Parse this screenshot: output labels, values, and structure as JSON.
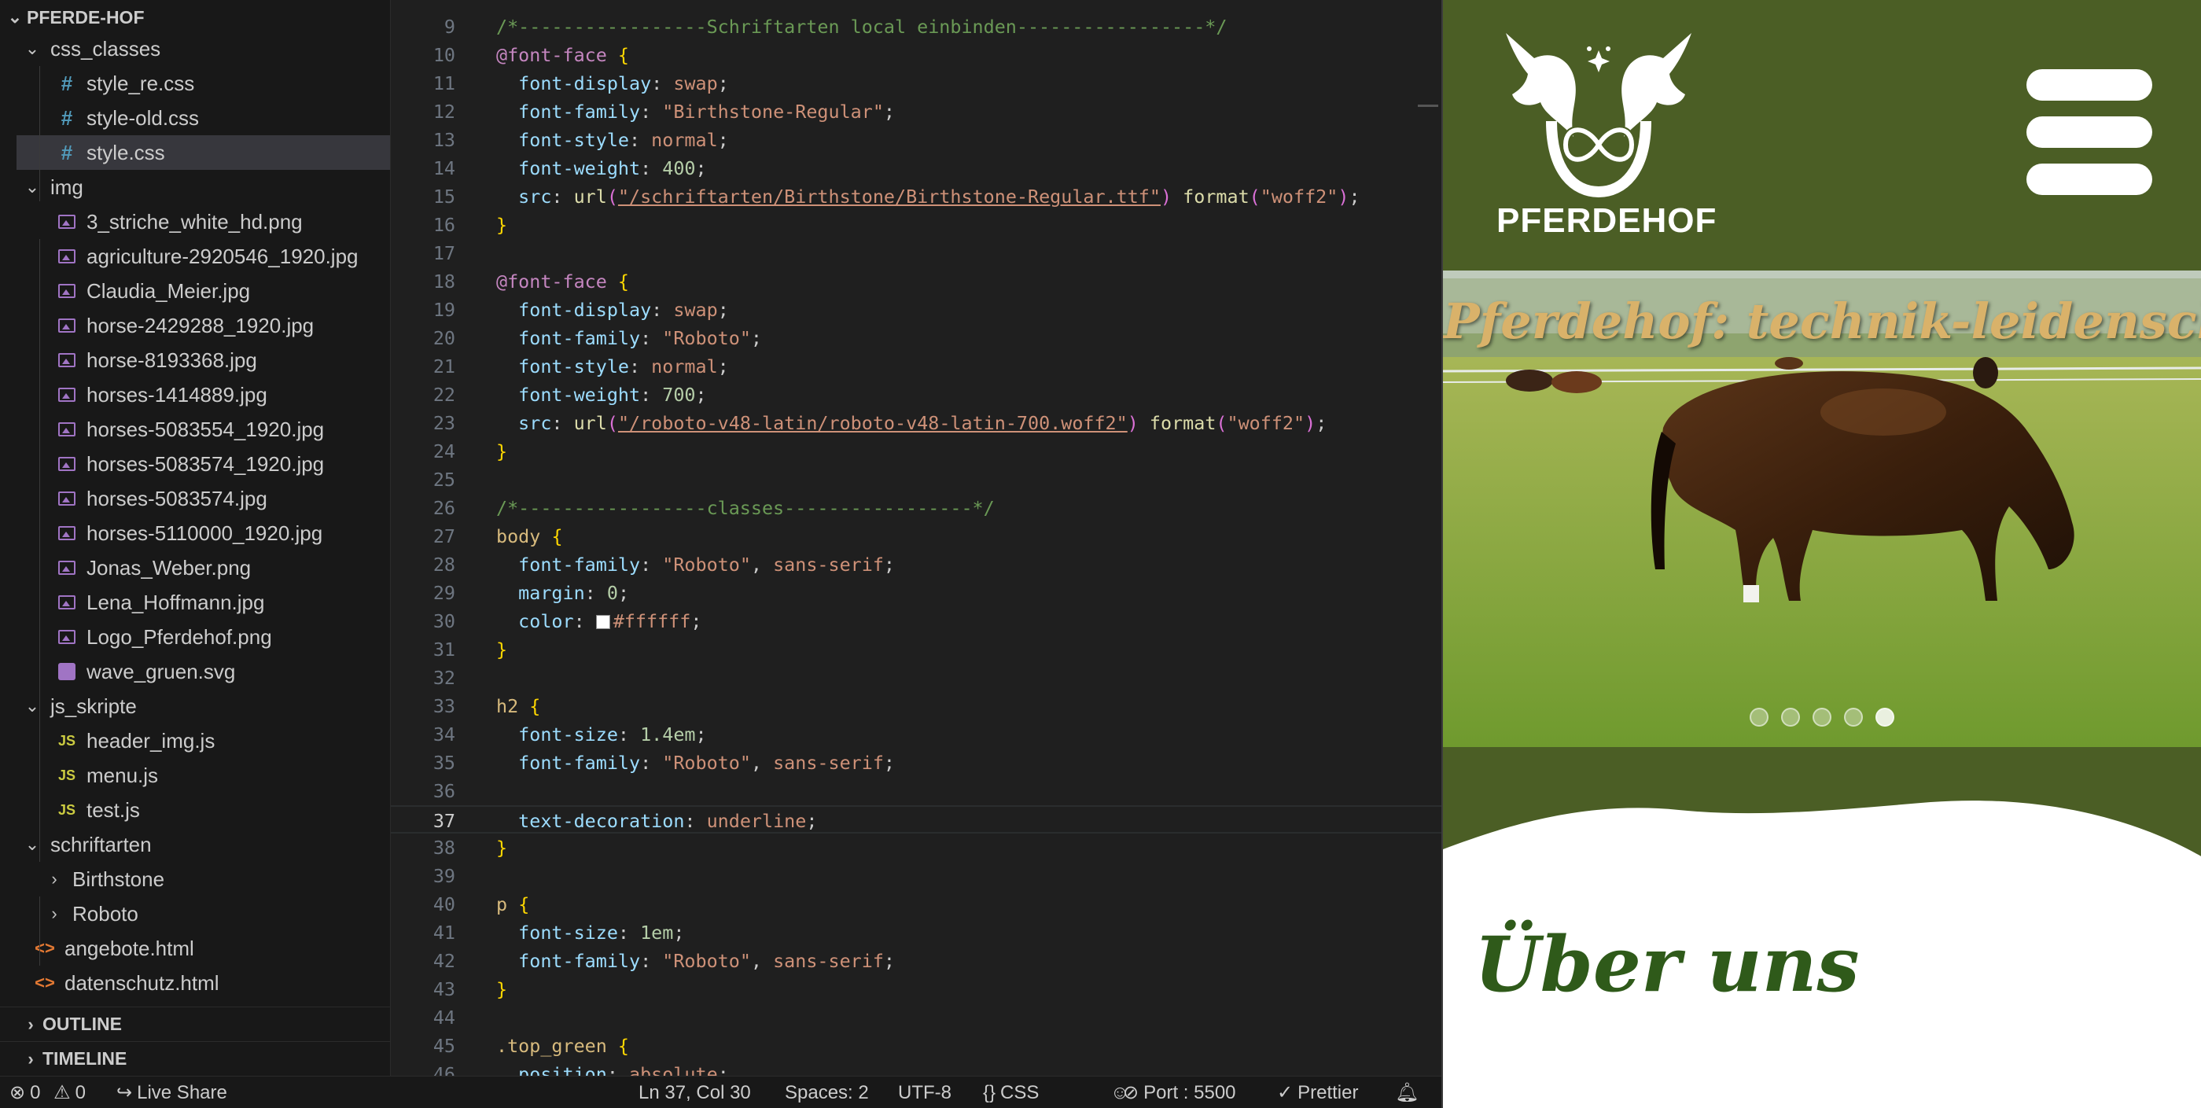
{
  "explorer": {
    "project": "PFERDE-HOF",
    "items": [
      {
        "label": "css_classes",
        "kind": "folder",
        "open": true,
        "depth": 1
      },
      {
        "label": "style_re.css",
        "kind": "css",
        "depth": 2
      },
      {
        "label": "style-old.css",
        "kind": "css",
        "depth": 2
      },
      {
        "label": "style.css",
        "kind": "css",
        "depth": 2,
        "selected": true
      },
      {
        "label": "img",
        "kind": "folder",
        "open": true,
        "depth": 1
      },
      {
        "label": "3_striche_white_hd.png",
        "kind": "image",
        "depth": 2
      },
      {
        "label": "agriculture-2920546_1920.jpg",
        "kind": "image",
        "depth": 2
      },
      {
        "label": "Claudia_Meier.jpg",
        "kind": "image",
        "depth": 2
      },
      {
        "label": "horse-2429288_1920.jpg",
        "kind": "image",
        "depth": 2
      },
      {
        "label": "horse-8193368.jpg",
        "kind": "image",
        "depth": 2
      },
      {
        "label": "horses-1414889.jpg",
        "kind": "image",
        "depth": 2
      },
      {
        "label": "horses-5083554_1920.jpg",
        "kind": "image",
        "depth": 2
      },
      {
        "label": "horses-5083574_1920.jpg",
        "kind": "image",
        "depth": 2
      },
      {
        "label": "horses-5083574.jpg",
        "kind": "image",
        "depth": 2
      },
      {
        "label": "horses-5110000_1920.jpg",
        "kind": "image",
        "depth": 2
      },
      {
        "label": "Jonas_Weber.png",
        "kind": "image",
        "depth": 2
      },
      {
        "label": "Lena_Hoffmann.jpg",
        "kind": "image",
        "depth": 2
      },
      {
        "label": "Logo_Pferdehof.png",
        "kind": "image",
        "depth": 2
      },
      {
        "label": "wave_gruen.svg",
        "kind": "svg",
        "depth": 2
      },
      {
        "label": "js_skripte",
        "kind": "folder",
        "open": true,
        "depth": 1
      },
      {
        "label": "header_img.js",
        "kind": "js",
        "depth": 2
      },
      {
        "label": "menu.js",
        "kind": "js",
        "depth": 2
      },
      {
        "label": "test.js",
        "kind": "js",
        "depth": 2
      },
      {
        "label": "schriftarten",
        "kind": "folder",
        "open": true,
        "depth": 1
      },
      {
        "label": "Birthstone",
        "kind": "folder",
        "open": false,
        "depth": 2
      },
      {
        "label": "Roboto",
        "kind": "folder",
        "open": false,
        "depth": 2
      },
      {
        "label": "angebote.html",
        "kind": "html",
        "depth": 1
      },
      {
        "label": "datenschutz.html",
        "kind": "html",
        "depth": 1
      }
    ],
    "sections": [
      "OUTLINE",
      "TIMELINE"
    ]
  },
  "editor": {
    "active_line": 37,
    "lines": [
      {
        "n": "9",
        "tokens": [
          [
            "com",
            "/*-----------------Schriftarten local einbinden-----------------*/"
          ]
        ]
      },
      {
        "n": "10",
        "tokens": [
          [
            "at",
            "@font-face"
          ],
          [
            "pun",
            " "
          ],
          [
            "brace",
            "{"
          ]
        ]
      },
      {
        "n": "11",
        "tokens": [
          [
            "pun",
            "  "
          ],
          [
            "prop",
            "font-display"
          ],
          [
            "pun",
            ": "
          ],
          [
            "val",
            "swap"
          ],
          [
            "pun",
            ";"
          ]
        ]
      },
      {
        "n": "12",
        "tokens": [
          [
            "pun",
            "  "
          ],
          [
            "prop",
            "font-family"
          ],
          [
            "pun",
            ": "
          ],
          [
            "val",
            "\"Birthstone-Regular\""
          ],
          [
            "pun",
            ";"
          ]
        ]
      },
      {
        "n": "13",
        "tokens": [
          [
            "pun",
            "  "
          ],
          [
            "prop",
            "font-style"
          ],
          [
            "pun",
            ": "
          ],
          [
            "val",
            "normal"
          ],
          [
            "pun",
            ";"
          ]
        ]
      },
      {
        "n": "14",
        "tokens": [
          [
            "pun",
            "  "
          ],
          [
            "prop",
            "font-weight"
          ],
          [
            "pun",
            ": "
          ],
          [
            "num",
            "400"
          ],
          [
            "pun",
            ";"
          ]
        ]
      },
      {
        "n": "15",
        "tokens": [
          [
            "pun",
            "  "
          ],
          [
            "prop",
            "src"
          ],
          [
            "pun",
            ": "
          ],
          [
            "fn",
            "url"
          ],
          [
            "par",
            "("
          ],
          [
            "url",
            "\"/schriftarten/Birthstone/Birthstone-Regular.ttf\""
          ],
          [
            "par",
            ")"
          ],
          [
            "pun",
            " "
          ],
          [
            "fn",
            "format"
          ],
          [
            "par",
            "("
          ],
          [
            "val",
            "\"woff2\""
          ],
          [
            "par",
            ")"
          ],
          [
            "pun",
            ";"
          ]
        ]
      },
      {
        "n": "16",
        "tokens": [
          [
            "brace",
            "}"
          ]
        ]
      },
      {
        "n": "17",
        "tokens": []
      },
      {
        "n": "18",
        "tokens": [
          [
            "at",
            "@font-face"
          ],
          [
            "pun",
            " "
          ],
          [
            "brace",
            "{"
          ]
        ]
      },
      {
        "n": "19",
        "tokens": [
          [
            "pun",
            "  "
          ],
          [
            "prop",
            "font-display"
          ],
          [
            "pun",
            ": "
          ],
          [
            "val",
            "swap"
          ],
          [
            "pun",
            ";"
          ]
        ]
      },
      {
        "n": "20",
        "tokens": [
          [
            "pun",
            "  "
          ],
          [
            "prop",
            "font-family"
          ],
          [
            "pun",
            ": "
          ],
          [
            "val",
            "\"Roboto\""
          ],
          [
            "pun",
            ";"
          ]
        ]
      },
      {
        "n": "21",
        "tokens": [
          [
            "pun",
            "  "
          ],
          [
            "prop",
            "font-style"
          ],
          [
            "pun",
            ": "
          ],
          [
            "val",
            "normal"
          ],
          [
            "pun",
            ";"
          ]
        ]
      },
      {
        "n": "22",
        "tokens": [
          [
            "pun",
            "  "
          ],
          [
            "prop",
            "font-weight"
          ],
          [
            "pun",
            ": "
          ],
          [
            "num",
            "700"
          ],
          [
            "pun",
            ";"
          ]
        ]
      },
      {
        "n": "23",
        "tokens": [
          [
            "pun",
            "  "
          ],
          [
            "prop",
            "src"
          ],
          [
            "pun",
            ": "
          ],
          [
            "fn",
            "url"
          ],
          [
            "par",
            "("
          ],
          [
            "url",
            "\"/roboto-v48-latin/roboto-v48-latin-700.woff2\""
          ],
          [
            "par",
            ")"
          ],
          [
            "pun",
            " "
          ],
          [
            "fn",
            "format"
          ],
          [
            "par",
            "("
          ],
          [
            "val",
            "\"woff2\""
          ],
          [
            "par",
            ")"
          ],
          [
            "pun",
            ";"
          ]
        ]
      },
      {
        "n": "24",
        "tokens": [
          [
            "brace",
            "}"
          ]
        ]
      },
      {
        "n": "25",
        "tokens": []
      },
      {
        "n": "26",
        "tokens": [
          [
            "com",
            "/*-----------------classes-----------------*/"
          ]
        ]
      },
      {
        "n": "27",
        "tokens": [
          [
            "sel",
            "body"
          ],
          [
            "pun",
            " "
          ],
          [
            "brace",
            "{"
          ]
        ]
      },
      {
        "n": "28",
        "tokens": [
          [
            "pun",
            "  "
          ],
          [
            "prop",
            "font-family"
          ],
          [
            "pun",
            ": "
          ],
          [
            "val",
            "\"Roboto\""
          ],
          [
            "pun",
            ", "
          ],
          [
            "val",
            "sans-serif"
          ],
          [
            "pun",
            ";"
          ]
        ]
      },
      {
        "n": "29",
        "tokens": [
          [
            "pun",
            "  "
          ],
          [
            "prop",
            "margin"
          ],
          [
            "pun",
            ": "
          ],
          [
            "num",
            "0"
          ],
          [
            "pun",
            ";"
          ]
        ]
      },
      {
        "n": "30",
        "tokens": [
          [
            "pun",
            "  "
          ],
          [
            "prop",
            "color"
          ],
          [
            "pun",
            ": "
          ],
          [
            "swatch",
            ""
          ],
          [
            "val",
            "#ffffff"
          ],
          [
            "pun",
            ";"
          ]
        ]
      },
      {
        "n": "31",
        "tokens": [
          [
            "brace",
            "}"
          ]
        ]
      },
      {
        "n": "32",
        "tokens": []
      },
      {
        "n": "33",
        "tokens": [
          [
            "sel",
            "h2"
          ],
          [
            "pun",
            " "
          ],
          [
            "brace",
            "{"
          ]
        ]
      },
      {
        "n": "34",
        "tokens": [
          [
            "pun",
            "  "
          ],
          [
            "prop",
            "font-size"
          ],
          [
            "pun",
            ": "
          ],
          [
            "num",
            "1.4em"
          ],
          [
            "pun",
            ";"
          ]
        ]
      },
      {
        "n": "35",
        "tokens": [
          [
            "pun",
            "  "
          ],
          [
            "prop",
            "font-family"
          ],
          [
            "pun",
            ": "
          ],
          [
            "val",
            "\"Roboto\""
          ],
          [
            "pun",
            ", "
          ],
          [
            "val",
            "sans-serif"
          ],
          [
            "pun",
            ";"
          ]
        ]
      },
      {
        "n": "36",
        "tokens": []
      },
      {
        "n": "37",
        "tokens": [
          [
            "pun",
            "  "
          ],
          [
            "prop",
            "text-decoration"
          ],
          [
            "pun",
            ": "
          ],
          [
            "val",
            "underline"
          ],
          [
            "pun",
            ";"
          ]
        ]
      },
      {
        "n": "38",
        "tokens": [
          [
            "brace",
            "}"
          ]
        ]
      },
      {
        "n": "39",
        "tokens": []
      },
      {
        "n": "40",
        "tokens": [
          [
            "sel",
            "p"
          ],
          [
            "pun",
            " "
          ],
          [
            "brace",
            "{"
          ]
        ]
      },
      {
        "n": "41",
        "tokens": [
          [
            "pun",
            "  "
          ],
          [
            "prop",
            "font-size"
          ],
          [
            "pun",
            ": "
          ],
          [
            "num",
            "1em"
          ],
          [
            "pun",
            ";"
          ]
        ]
      },
      {
        "n": "42",
        "tokens": [
          [
            "pun",
            "  "
          ],
          [
            "prop",
            "font-family"
          ],
          [
            "pun",
            ": "
          ],
          [
            "val",
            "\"Roboto\""
          ],
          [
            "pun",
            ", "
          ],
          [
            "val",
            "sans-serif"
          ],
          [
            "pun",
            ";"
          ]
        ]
      },
      {
        "n": "43",
        "tokens": [
          [
            "brace",
            "}"
          ]
        ]
      },
      {
        "n": "44",
        "tokens": []
      },
      {
        "n": "45",
        "tokens": [
          [
            "sel",
            ".top_green"
          ],
          [
            "pun",
            " "
          ],
          [
            "brace",
            "{"
          ]
        ]
      },
      {
        "n": "46",
        "tokens": [
          [
            "pun",
            "  "
          ],
          [
            "prop",
            "position"
          ],
          [
            "pun",
            ": "
          ],
          [
            "val",
            "absolute"
          ],
          [
            "pun",
            ";"
          ]
        ]
      }
    ]
  },
  "preview": {
    "logo_text": "PFERDEHOF",
    "hero_title": "Pferdehof: technik-leidenschaft",
    "slide_count": 5,
    "active_slide": 5,
    "about_heading": "Über uns",
    "colors": {
      "header_green": "#4b5e25",
      "title_gold": "#d9b26a",
      "heading_green": "#2f5a1a"
    }
  },
  "statusbar": {
    "errors": "0",
    "warnings": "0",
    "live_share": "Live Share",
    "cursor": "Ln 37, Col 30",
    "spaces": "Spaces: 2",
    "encoding": "UTF-8",
    "language": "CSS",
    "port": "Port : 5500",
    "prettier": "Prettier"
  }
}
